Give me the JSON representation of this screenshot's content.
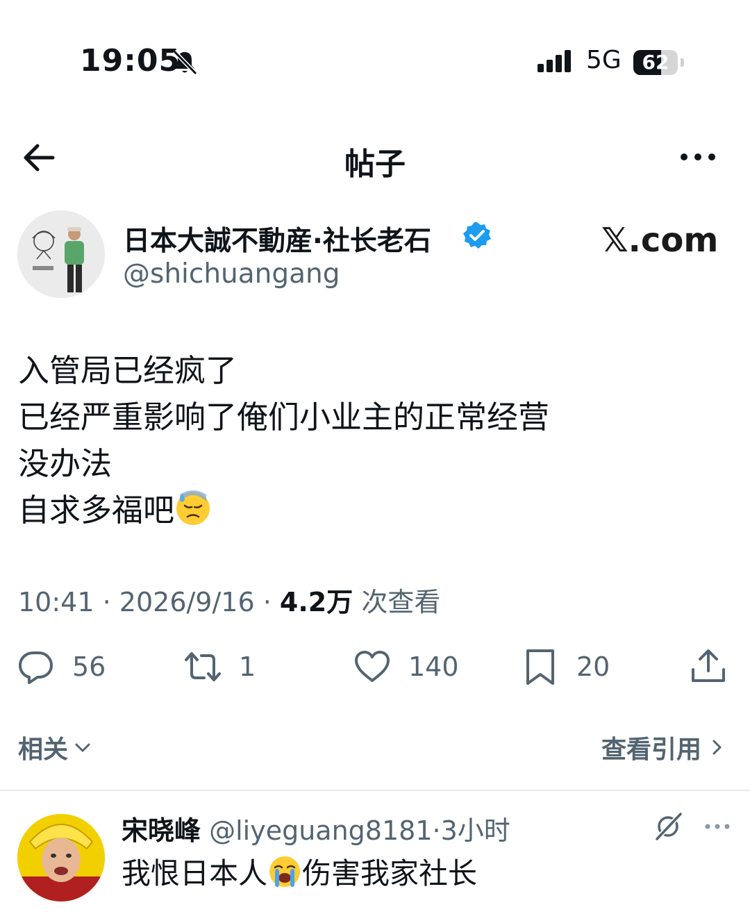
{
  "status_bar": {
    "time": "19:05",
    "network": "5G",
    "battery": "62",
    "battery_level": 0.62
  },
  "nav": {
    "title": "帖子"
  },
  "post": {
    "author_name": "日本大誠不動産·社长老石",
    "author_handle": "@shichuangang",
    "watermark": "𝕏.com",
    "body_lines": [
      "入管局已经疯了",
      "已经严重影响了俺们小业主的正常经营",
      "没办法",
      "自求多福吧"
    ],
    "body_emoji": "downcast-face-with-sweat-emoji",
    "time": "10:41",
    "separator": "·",
    "date": "2026/9/16",
    "views": "4.2万",
    "views_label": "次查看",
    "actions": {
      "replies": "56",
      "reposts": "1",
      "likes": "140",
      "bookmarks": "20"
    }
  },
  "related": {
    "label": "相关",
    "quotes_label": "查看引用"
  },
  "reply": {
    "name": "宋晓峰",
    "handle": "@liyeguang8181",
    "separator": "·",
    "time": "3小时",
    "text_before": "我恨日本人",
    "emoji": "loudly-crying-face-emoji",
    "text_after": "伤害我家社长"
  },
  "colors": {
    "text": "#0f1419",
    "secondary": "#536471",
    "verified": "#1d9bf0",
    "divider": "#e6e6e6"
  }
}
